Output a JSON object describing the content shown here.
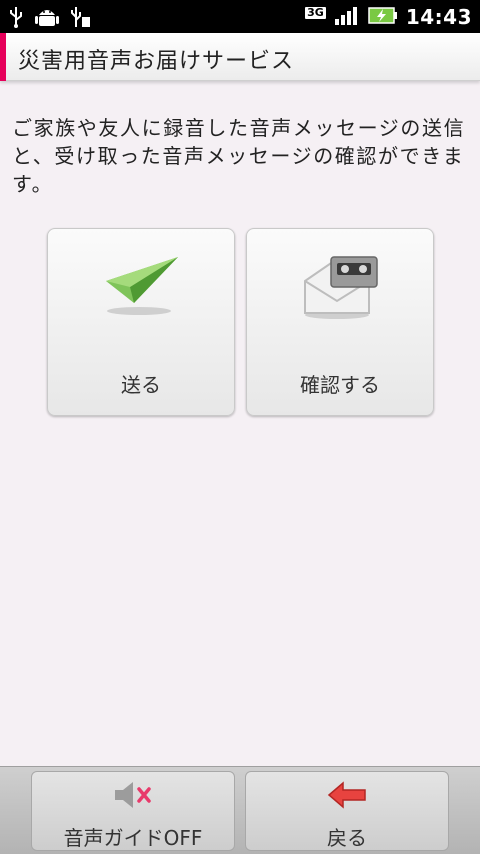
{
  "status_bar": {
    "left_icons": [
      "usb-icon",
      "android-debug-icon",
      "usb-storage-icon"
    ],
    "network": "3G",
    "time": "14:43",
    "right_icons": [
      "signal-icon",
      "battery-charging-icon"
    ]
  },
  "header": {
    "title": "災害用音声お届けサービス",
    "accent_color": "#e6005a"
  },
  "description": "ご家族や友人に録音した音声メッセージの送信と、受け取った音声メッセージの確認ができます。",
  "actions": {
    "send_label": "送る",
    "confirm_label": "確認する"
  },
  "bottom_bar": {
    "voice_guide_label": "音声ガイドOFF",
    "back_label": "戻る"
  }
}
